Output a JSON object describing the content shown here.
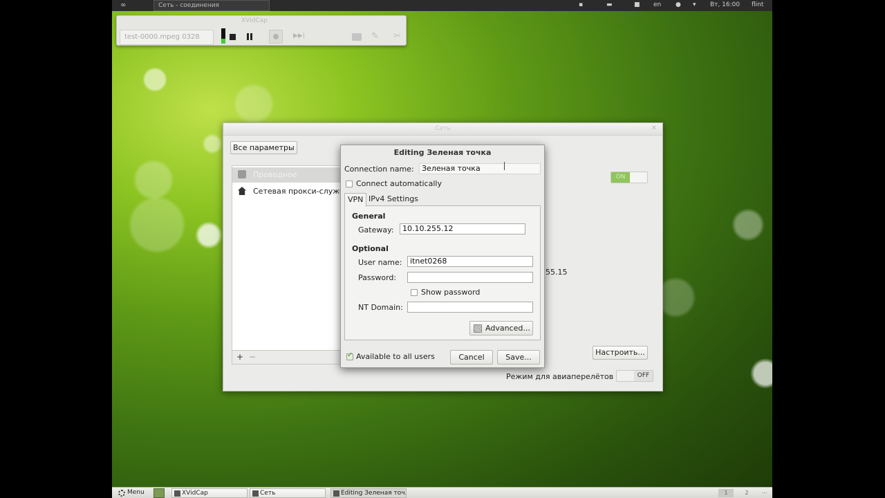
{
  "top_panel": {
    "task_label": "Сеть - соединения",
    "time": "Вт, 16:00",
    "layout": "en",
    "user": "flint"
  },
  "xvidcap": {
    "title": "XVidCap",
    "filename": "test-0000.mpeg 0328",
    "next_label": "▶▶|"
  },
  "network_window": {
    "title": "Сеть",
    "all_settings_label": "Все параметры",
    "list_items": [
      {
        "label": "Проводное"
      },
      {
        "label": "Сетевая прокси-служба"
      }
    ],
    "on_switch_label": "ON",
    "ip_tail": "55.15",
    "configure_label": "Настроить...",
    "airplane_label": "Режим для авиаперелётов",
    "airplane_state": "OFF",
    "add_label": "+",
    "remove_label": "−"
  },
  "edit_dialog": {
    "title": "Editing Зеленая точка",
    "connection_name_label": "Connection name:",
    "connection_name_value": "Зеленая точка",
    "connect_auto_label": "Connect automatically",
    "tabs": [
      {
        "label": "VPN"
      },
      {
        "label": "IPv4 Settings"
      }
    ],
    "general_header": "General",
    "gateway_label": "Gateway:",
    "gateway_value": "10.10.255.12",
    "optional_header": "Optional",
    "username_label": "User name:",
    "username_value": "itnet0268",
    "password_label": "Password:",
    "password_value": "",
    "show_password_label": "Show password",
    "nt_domain_label": "NT Domain:",
    "nt_domain_value": "",
    "advanced_label": "Advanced...",
    "available_label": "Available to all users",
    "available_checked": true,
    "cancel_label": "Cancel",
    "save_label": "Save..."
  },
  "bottom_panel": {
    "menu_label": "Menu",
    "tasks": [
      {
        "label": "XVidCap"
      },
      {
        "label": "Сеть"
      },
      {
        "label": "Editing Зеленая точ..."
      }
    ],
    "workspaces": [
      "1",
      "2"
    ],
    "corner_label": "..."
  }
}
